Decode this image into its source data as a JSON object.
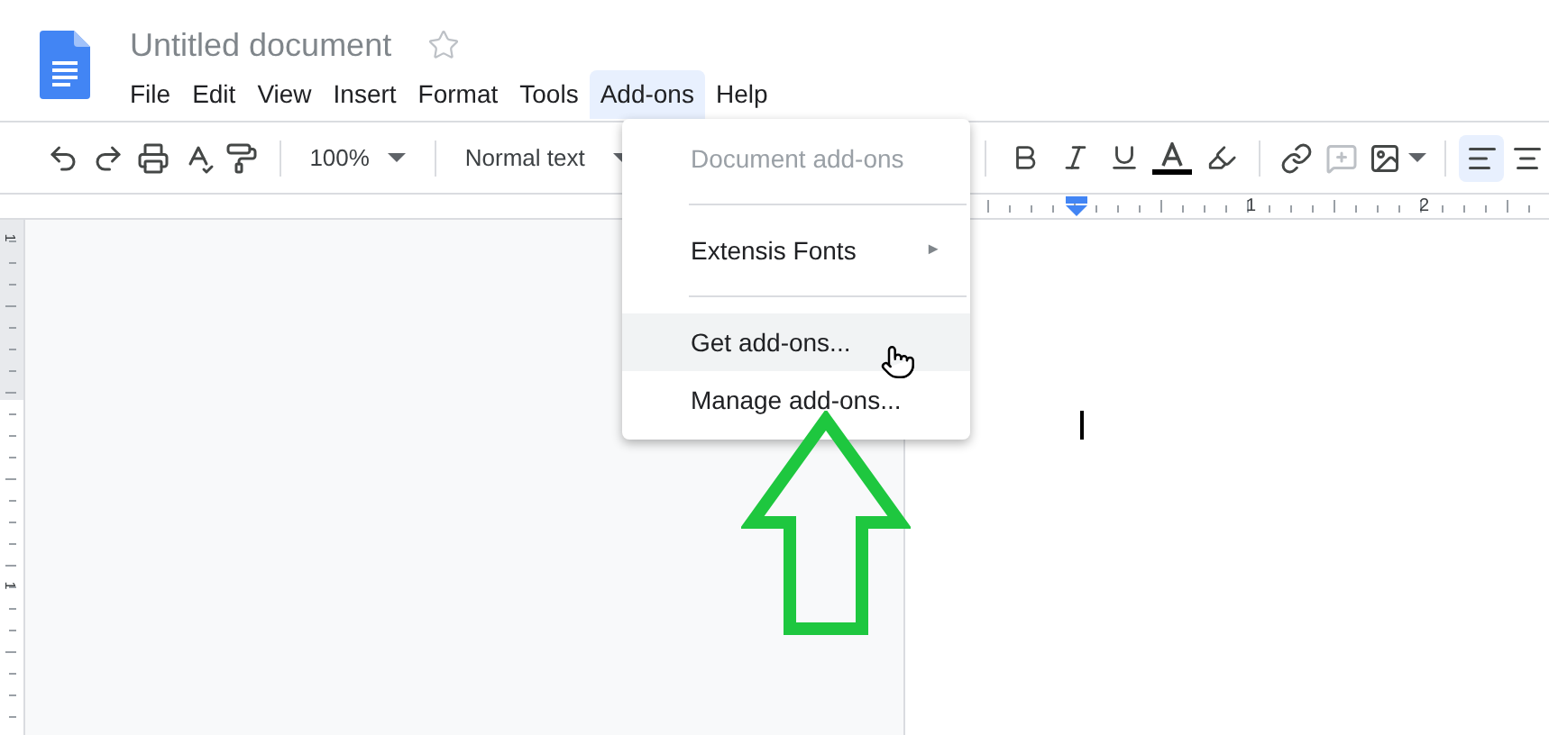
{
  "document": {
    "title": "Untitled document",
    "starred": false
  },
  "menu_bar": [
    {
      "label": "File",
      "selected": false
    },
    {
      "label": "Edit",
      "selected": false
    },
    {
      "label": "View",
      "selected": false
    },
    {
      "label": "Insert",
      "selected": false
    },
    {
      "label": "Format",
      "selected": false
    },
    {
      "label": "Tools",
      "selected": false
    },
    {
      "label": "Add-ons",
      "selected": true
    },
    {
      "label": "Help",
      "selected": false
    }
  ],
  "toolbar": {
    "zoom": "100%",
    "style": "Normal text",
    "alignment": [
      {
        "selected": true
      },
      {
        "selected": false
      }
    ]
  },
  "ruler": {
    "horizontal_labels": [
      "1",
      "2"
    ],
    "vertical_labels": [
      "1",
      "1"
    ]
  },
  "addons_menu": [
    {
      "kind": "item",
      "label": "Document add-ons",
      "disabled": true,
      "hovered": false
    },
    {
      "kind": "separator"
    },
    {
      "kind": "submenu",
      "label": "Extensis Fonts",
      "arrow": "►",
      "disabled": false,
      "hovered": false
    },
    {
      "kind": "separator"
    },
    {
      "kind": "item",
      "label": "Get add-ons...",
      "disabled": false,
      "hovered": true
    },
    {
      "kind": "item",
      "label": "Manage add-ons...",
      "disabled": false,
      "hovered": false
    }
  ]
}
